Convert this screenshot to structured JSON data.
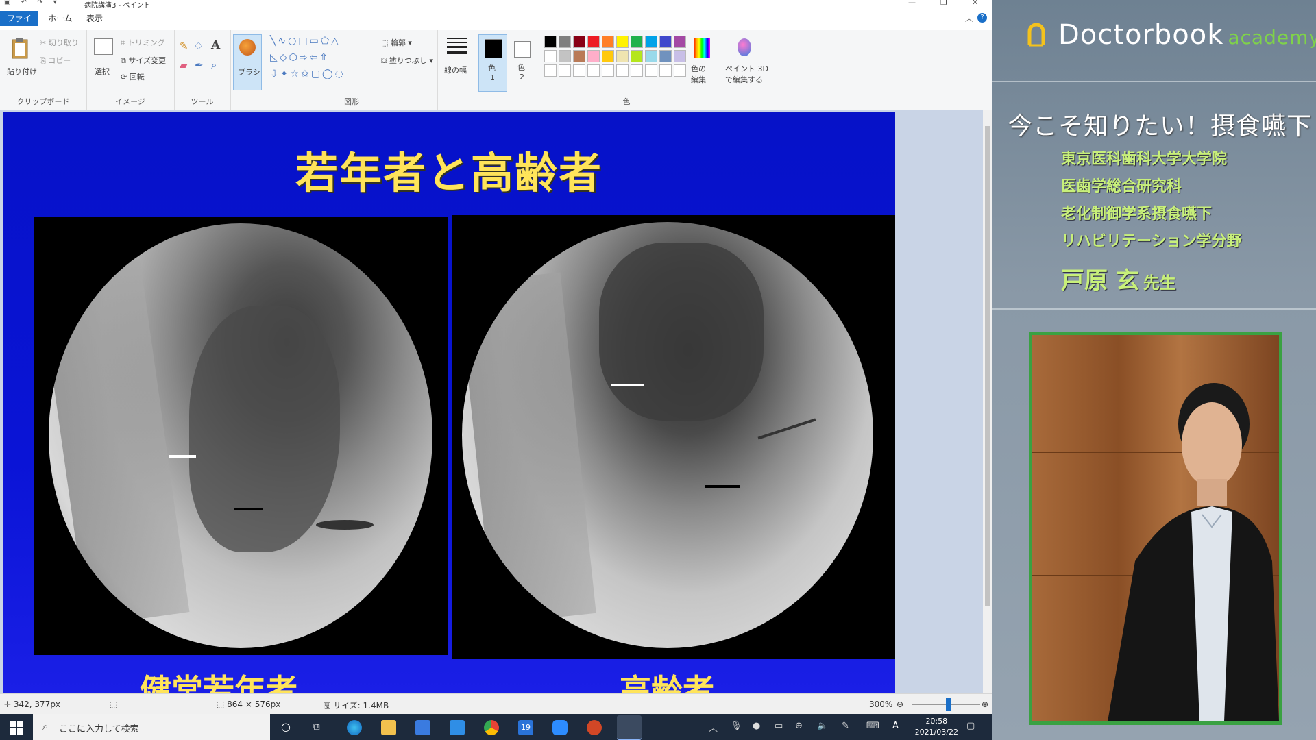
{
  "titlebar": {
    "title": "病院講演3 - ペイント"
  },
  "tabs": {
    "file": "ファイル",
    "home": "ホーム",
    "view": "表示"
  },
  "ribbon": {
    "clipboard": {
      "paste": "貼り付け",
      "cut": "切り取り",
      "copy": "コピー",
      "label": "クリップボード"
    },
    "image": {
      "select": "選択",
      "crop": "トリミング",
      "resize": "サイズ変更",
      "rotate": "回転",
      "label": "イメージ"
    },
    "tools": {
      "label": "ツール",
      "text_tool": "A"
    },
    "brush": {
      "label": "ブラシ"
    },
    "shapes": {
      "outline": "輪郭",
      "fill": "塗りつぶし",
      "label": "図形"
    },
    "size": {
      "label": "線の幅"
    },
    "color1": {
      "line1": "色",
      "line2": "1"
    },
    "color2": {
      "line1": "色",
      "line2": "2"
    },
    "colors": {
      "label": "色",
      "edit_line1": "色の",
      "edit_line2": "編集",
      "palette_row1": [
        "#000000",
        "#7f7f7f",
        "#880015",
        "#ed1c24",
        "#ff7f27",
        "#fff200",
        "#22b14c",
        "#00a2e8",
        "#3f48cc",
        "#a349a4"
      ],
      "palette_row2": [
        "#ffffff",
        "#c3c3c3",
        "#b97a57",
        "#ffaec9",
        "#ffc90e",
        "#efe4b0",
        "#b5e61d",
        "#99d9ea",
        "#7092be",
        "#c8bfe7"
      ]
    },
    "paint3d": {
      "line1": "ペイント 3D",
      "line2": "で編集する"
    }
  },
  "slide": {
    "title": "若年者と高齢者",
    "caption_left": "健常若年者",
    "caption_right": "高齢者"
  },
  "statusbar": {
    "cursor": "342, 377px",
    "dimensions": "864 × 576px",
    "filesize": "サイズ: 1.4MB",
    "zoom": "300%"
  },
  "taskbar": {
    "search_placeholder": "ここに入力して検索",
    "time": "20:58",
    "date": "2021/03/22",
    "calendar_day": "19",
    "ime": "A"
  },
  "panel": {
    "brand": "Doctorbook",
    "brand_suffix": "academy",
    "course_title": "今こそ知りたい！摂食嚥下",
    "affiliation": [
      "東京医科歯科大学大学院",
      "医歯学総合研究科",
      "老化制御学系摂食嚥下",
      "リハビリテーション学分野"
    ],
    "lecturer": "戸原 玄",
    "lecturer_suffix": "先生",
    "accent": "#3aa142"
  }
}
